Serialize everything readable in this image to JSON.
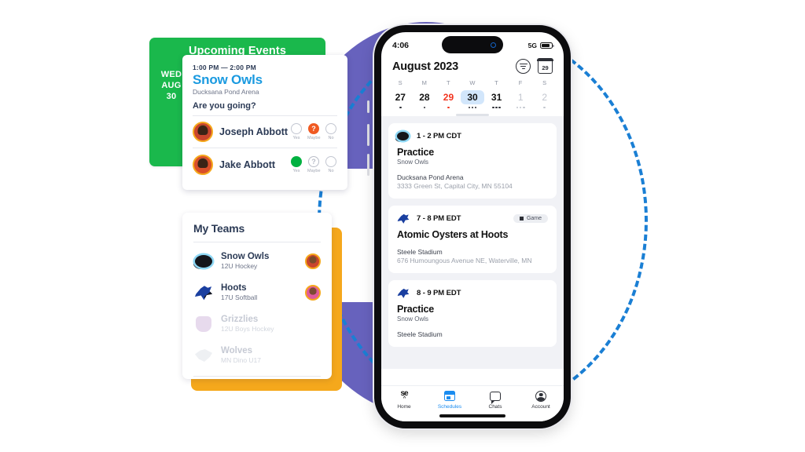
{
  "colors": {
    "purple": "#6762bd",
    "green": "#1ab84c",
    "yellow": "#f5a81c",
    "blue_accent": "#1a9ae0",
    "dashed_blue": "#1a7fd4",
    "red": "#f2341f",
    "orange": "#f05a22",
    "rsvp_green": "#00b140"
  },
  "upcoming_events": {
    "title": "Upcoming Events",
    "date_badge": {
      "dow": "WED",
      "month": "AUG",
      "day": "30"
    },
    "event": {
      "time": "1:00 PM — 2:00 PM",
      "team": "Snow Owls",
      "venue": "Ducksana Pond Arena",
      "question": "Are you going?"
    },
    "option_labels": {
      "yes": "Yes",
      "maybe": "Maybe",
      "no": "No"
    },
    "attendees": [
      {
        "name": "Joseph Abbott",
        "status": "maybe",
        "maybe_glyph": "?"
      },
      {
        "name": "Jake Abbott",
        "status": "yes",
        "maybe_glyph": "?"
      }
    ]
  },
  "my_teams": {
    "title": "My Teams",
    "teams": [
      {
        "name": "Snow Owls",
        "sub": "12U Hockey",
        "logo": "hockey-puck-owl-logo",
        "avatar": "orange",
        "dim": false
      },
      {
        "name": "Hoots",
        "sub": "17U Softball",
        "logo": "blue-bird-logo",
        "avatar": "pink",
        "dim": false
      },
      {
        "name": "Grizzlies",
        "sub": "12U Boys Hockey",
        "logo": "bear-head-logo",
        "avatar": null,
        "dim": true
      },
      {
        "name": "Wolves",
        "sub": "MN Dino U17",
        "logo": "wolf-head-logo",
        "avatar": null,
        "dim": true
      }
    ]
  },
  "phone": {
    "status_bar": {
      "time": "4:06",
      "network": "5G"
    },
    "header": {
      "month": "August 2023",
      "filter_icon": "filter-icon",
      "calendar_icon_day": "29"
    },
    "week": {
      "dow": [
        "S",
        "M",
        "T",
        "W",
        "T",
        "F",
        "S"
      ],
      "days": [
        {
          "num": "27",
          "state": "normal",
          "dots": 1
        },
        {
          "num": "28",
          "state": "normal",
          "dots": 1
        },
        {
          "num": "29",
          "state": "red",
          "dots": 1
        },
        {
          "num": "30",
          "state": "selected",
          "dots": 3
        },
        {
          "num": "31",
          "state": "normal",
          "dots": 3
        },
        {
          "num": "1",
          "state": "muted",
          "dots": 3
        },
        {
          "num": "2",
          "state": "muted",
          "dots": 1
        }
      ]
    },
    "events": [
      {
        "logo": "hockey-puck-owl-logo",
        "time": "1 - 2 PM CDT",
        "badge": null,
        "title": "Practice",
        "team": "Snow Owls",
        "place": "Ducksana Pond Arena",
        "address": "3333 Green St, Capital City, MN 55104"
      },
      {
        "logo": "blue-bird-logo",
        "time": "7 - 8 PM EDT",
        "badge": "Game",
        "title": "Atomic Oysters at Hoots",
        "team": "",
        "place": "Steele Stadium",
        "address": "676 Humoungous Avenue NE, Waterville, MN"
      },
      {
        "logo": "blue-bird-logo",
        "time": "8 - 9 PM EDT",
        "badge": null,
        "title": "Practice",
        "team": "Snow Owls",
        "place": "Steele Stadium",
        "address": ""
      }
    ],
    "tabs": [
      {
        "label": "Home",
        "icon": "se-logo-icon",
        "active": false
      },
      {
        "label": "Schedules",
        "icon": "schedules-icon",
        "active": true
      },
      {
        "label": "Chats",
        "icon": "chat-bubble-icon",
        "active": false
      },
      {
        "label": "Account",
        "icon": "account-icon",
        "active": false
      }
    ]
  }
}
